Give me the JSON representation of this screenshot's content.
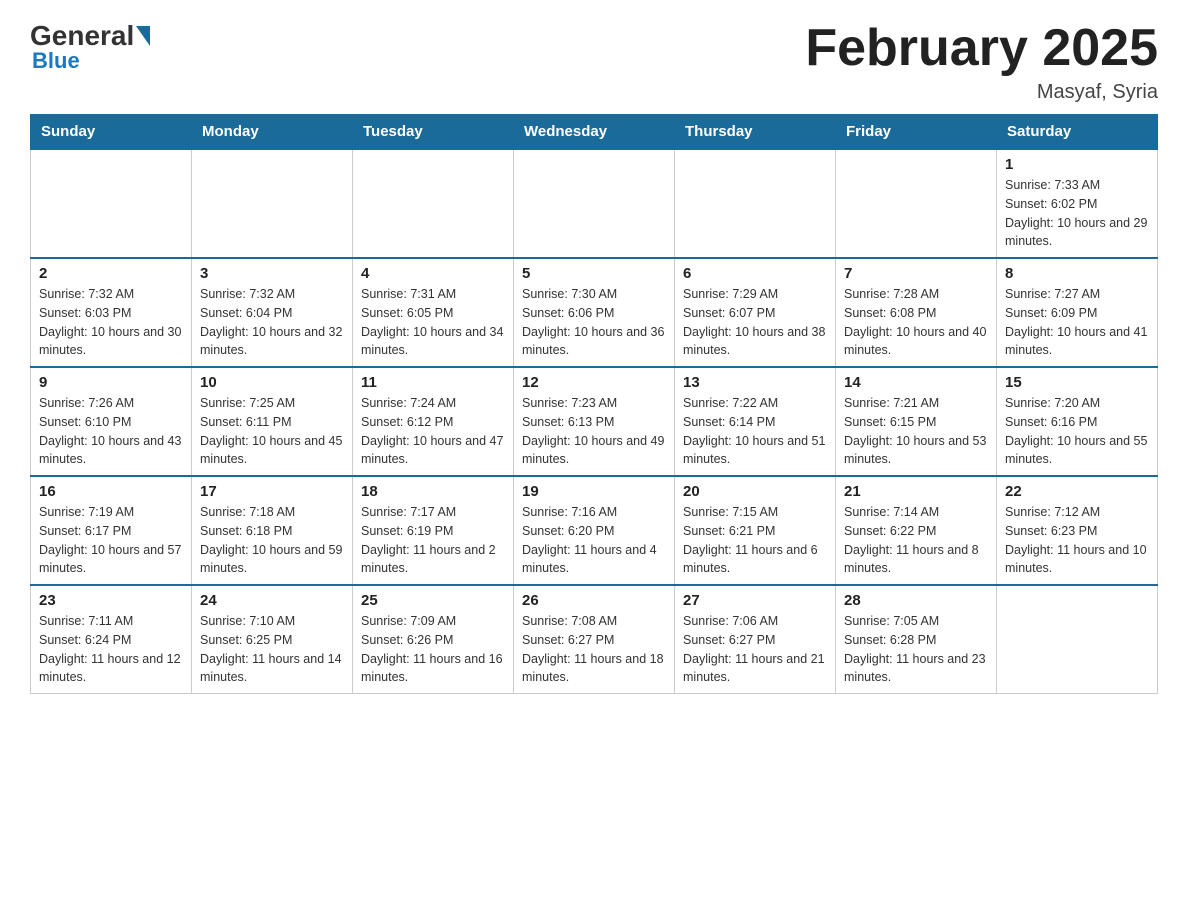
{
  "header": {
    "logo_general": "General",
    "logo_blue": "Blue",
    "title": "February 2025",
    "subtitle": "Masyaf, Syria"
  },
  "days_of_week": [
    "Sunday",
    "Monday",
    "Tuesday",
    "Wednesday",
    "Thursday",
    "Friday",
    "Saturday"
  ],
  "weeks": [
    [
      {
        "day": "",
        "sunrise": "",
        "sunset": "",
        "daylight": ""
      },
      {
        "day": "",
        "sunrise": "",
        "sunset": "",
        "daylight": ""
      },
      {
        "day": "",
        "sunrise": "",
        "sunset": "",
        "daylight": ""
      },
      {
        "day": "",
        "sunrise": "",
        "sunset": "",
        "daylight": ""
      },
      {
        "day": "",
        "sunrise": "",
        "sunset": "",
        "daylight": ""
      },
      {
        "day": "",
        "sunrise": "",
        "sunset": "",
        "daylight": ""
      },
      {
        "day": "1",
        "sunrise": "Sunrise: 7:33 AM",
        "sunset": "Sunset: 6:02 PM",
        "daylight": "Daylight: 10 hours and 29 minutes."
      }
    ],
    [
      {
        "day": "2",
        "sunrise": "Sunrise: 7:32 AM",
        "sunset": "Sunset: 6:03 PM",
        "daylight": "Daylight: 10 hours and 30 minutes."
      },
      {
        "day": "3",
        "sunrise": "Sunrise: 7:32 AM",
        "sunset": "Sunset: 6:04 PM",
        "daylight": "Daylight: 10 hours and 32 minutes."
      },
      {
        "day": "4",
        "sunrise": "Sunrise: 7:31 AM",
        "sunset": "Sunset: 6:05 PM",
        "daylight": "Daylight: 10 hours and 34 minutes."
      },
      {
        "day": "5",
        "sunrise": "Sunrise: 7:30 AM",
        "sunset": "Sunset: 6:06 PM",
        "daylight": "Daylight: 10 hours and 36 minutes."
      },
      {
        "day": "6",
        "sunrise": "Sunrise: 7:29 AM",
        "sunset": "Sunset: 6:07 PM",
        "daylight": "Daylight: 10 hours and 38 minutes."
      },
      {
        "day": "7",
        "sunrise": "Sunrise: 7:28 AM",
        "sunset": "Sunset: 6:08 PM",
        "daylight": "Daylight: 10 hours and 40 minutes."
      },
      {
        "day": "8",
        "sunrise": "Sunrise: 7:27 AM",
        "sunset": "Sunset: 6:09 PM",
        "daylight": "Daylight: 10 hours and 41 minutes."
      }
    ],
    [
      {
        "day": "9",
        "sunrise": "Sunrise: 7:26 AM",
        "sunset": "Sunset: 6:10 PM",
        "daylight": "Daylight: 10 hours and 43 minutes."
      },
      {
        "day": "10",
        "sunrise": "Sunrise: 7:25 AM",
        "sunset": "Sunset: 6:11 PM",
        "daylight": "Daylight: 10 hours and 45 minutes."
      },
      {
        "day": "11",
        "sunrise": "Sunrise: 7:24 AM",
        "sunset": "Sunset: 6:12 PM",
        "daylight": "Daylight: 10 hours and 47 minutes."
      },
      {
        "day": "12",
        "sunrise": "Sunrise: 7:23 AM",
        "sunset": "Sunset: 6:13 PM",
        "daylight": "Daylight: 10 hours and 49 minutes."
      },
      {
        "day": "13",
        "sunrise": "Sunrise: 7:22 AM",
        "sunset": "Sunset: 6:14 PM",
        "daylight": "Daylight: 10 hours and 51 minutes."
      },
      {
        "day": "14",
        "sunrise": "Sunrise: 7:21 AM",
        "sunset": "Sunset: 6:15 PM",
        "daylight": "Daylight: 10 hours and 53 minutes."
      },
      {
        "day": "15",
        "sunrise": "Sunrise: 7:20 AM",
        "sunset": "Sunset: 6:16 PM",
        "daylight": "Daylight: 10 hours and 55 minutes."
      }
    ],
    [
      {
        "day": "16",
        "sunrise": "Sunrise: 7:19 AM",
        "sunset": "Sunset: 6:17 PM",
        "daylight": "Daylight: 10 hours and 57 minutes."
      },
      {
        "day": "17",
        "sunrise": "Sunrise: 7:18 AM",
        "sunset": "Sunset: 6:18 PM",
        "daylight": "Daylight: 10 hours and 59 minutes."
      },
      {
        "day": "18",
        "sunrise": "Sunrise: 7:17 AM",
        "sunset": "Sunset: 6:19 PM",
        "daylight": "Daylight: 11 hours and 2 minutes."
      },
      {
        "day": "19",
        "sunrise": "Sunrise: 7:16 AM",
        "sunset": "Sunset: 6:20 PM",
        "daylight": "Daylight: 11 hours and 4 minutes."
      },
      {
        "day": "20",
        "sunrise": "Sunrise: 7:15 AM",
        "sunset": "Sunset: 6:21 PM",
        "daylight": "Daylight: 11 hours and 6 minutes."
      },
      {
        "day": "21",
        "sunrise": "Sunrise: 7:14 AM",
        "sunset": "Sunset: 6:22 PM",
        "daylight": "Daylight: 11 hours and 8 minutes."
      },
      {
        "day": "22",
        "sunrise": "Sunrise: 7:12 AM",
        "sunset": "Sunset: 6:23 PM",
        "daylight": "Daylight: 11 hours and 10 minutes."
      }
    ],
    [
      {
        "day": "23",
        "sunrise": "Sunrise: 7:11 AM",
        "sunset": "Sunset: 6:24 PM",
        "daylight": "Daylight: 11 hours and 12 minutes."
      },
      {
        "day": "24",
        "sunrise": "Sunrise: 7:10 AM",
        "sunset": "Sunset: 6:25 PM",
        "daylight": "Daylight: 11 hours and 14 minutes."
      },
      {
        "day": "25",
        "sunrise": "Sunrise: 7:09 AM",
        "sunset": "Sunset: 6:26 PM",
        "daylight": "Daylight: 11 hours and 16 minutes."
      },
      {
        "day": "26",
        "sunrise": "Sunrise: 7:08 AM",
        "sunset": "Sunset: 6:27 PM",
        "daylight": "Daylight: 11 hours and 18 minutes."
      },
      {
        "day": "27",
        "sunrise": "Sunrise: 7:06 AM",
        "sunset": "Sunset: 6:27 PM",
        "daylight": "Daylight: 11 hours and 21 minutes."
      },
      {
        "day": "28",
        "sunrise": "Sunrise: 7:05 AM",
        "sunset": "Sunset: 6:28 PM",
        "daylight": "Daylight: 11 hours and 23 minutes."
      },
      {
        "day": "",
        "sunrise": "",
        "sunset": "",
        "daylight": ""
      }
    ]
  ]
}
